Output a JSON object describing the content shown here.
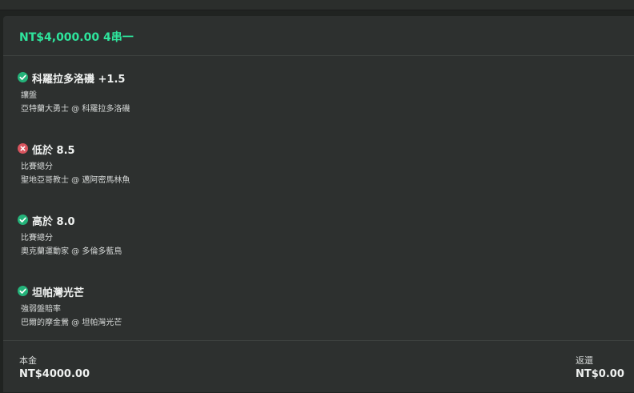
{
  "bet": {
    "header_title": "NT$4,000.00 4串一",
    "legs": [
      {
        "status": "won",
        "icon": "check-icon",
        "selection": "科羅拉多洛磯 +1.5",
        "market": "讓盤",
        "event": "亞特蘭大勇士 @ 科羅拉多洛磯"
      },
      {
        "status": "lost",
        "icon": "cross-icon",
        "selection": "低於 8.5",
        "market": "比賽總分",
        "event": "聖地亞哥教士 @ 邁阿密馬林魚"
      },
      {
        "status": "won",
        "icon": "check-icon",
        "selection": "高於 8.0",
        "market": "比賽總分",
        "event": "奧克蘭運動家 @ 多倫多藍鳥"
      },
      {
        "status": "won",
        "icon": "check-icon",
        "selection": "坦帕灣光芒",
        "market": "強弱盤賠率",
        "event": "巴爾的摩金鶯 @ 坦帕灣光芒"
      }
    ],
    "stake_label": "本金",
    "stake_value": "NT$4000.00",
    "return_label": "返還",
    "return_value": "NT$0.00"
  },
  "colors": {
    "accent": "#2ee59d",
    "won": "#24b37a",
    "lost": "#d8545e",
    "card_bg": "#2d302f",
    "page_bg": "#202321"
  }
}
